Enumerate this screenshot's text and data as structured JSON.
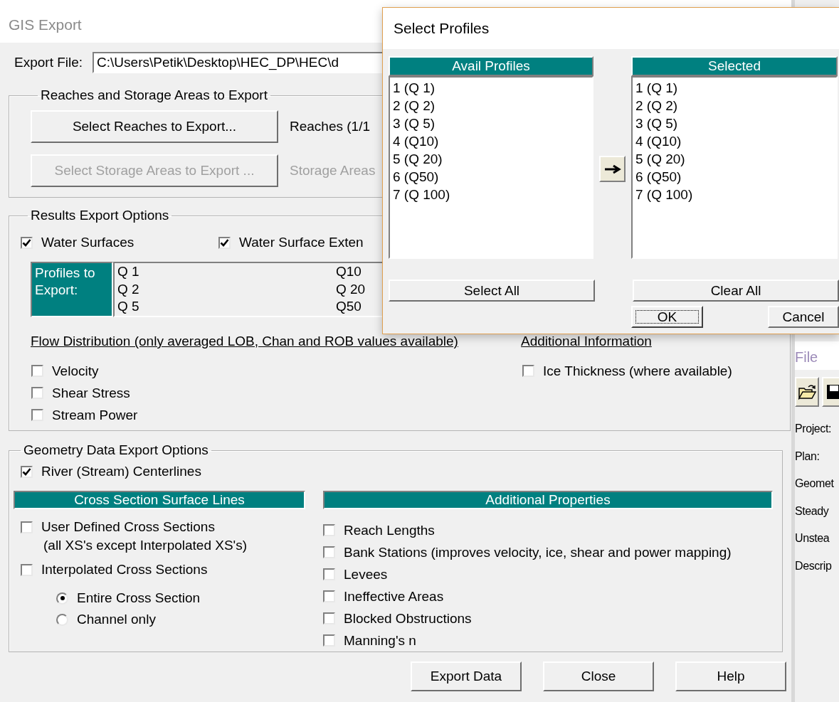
{
  "gis_export": {
    "title": "GIS Export",
    "export_file": {
      "label": "Export File:",
      "value": "C:\\Users\\Petik\\Desktop\\HEC_DP\\HEC\\d"
    },
    "reaches_group": {
      "title": "Reaches and Storage Areas to Export",
      "rows": [
        {
          "button": "Select Reaches to Export...",
          "status": "Reaches (1/1",
          "disabled": false
        },
        {
          "button": "Select Storage Areas to Export ...",
          "status": "Storage Areas",
          "disabled": true
        }
      ]
    },
    "results_group": {
      "title": "Results Export Options",
      "options": [
        {
          "label": "Water Surfaces",
          "checked": true
        },
        {
          "label": "Water Surface Exten",
          "checked": true
        }
      ],
      "profiles_label": "Profiles to Export:",
      "profile_columns": [
        {
          "items": [
            "Q 1",
            "Q 2",
            "Q 5"
          ]
        },
        {
          "items": [
            "Q10",
            "Q 20",
            "Q50"
          ]
        }
      ],
      "flow_distribution": {
        "title": "Flow Distribution (only averaged LOB, Chan and ROB values available)",
        "options": [
          {
            "label": "Velocity",
            "checked": false
          },
          {
            "label": "Shear Stress",
            "checked": false
          },
          {
            "label": "Stream Power",
            "checked": false
          }
        ]
      },
      "additional_information": {
        "title": "Additional Information",
        "options": [
          {
            "label": "Ice Thickness (where available)",
            "checked": false
          }
        ]
      }
    },
    "geometry_group": {
      "title": "Geometry Data Export Options",
      "centerlines": {
        "label": "River (Stream) Centerlines",
        "checked": true
      },
      "cross_sections": {
        "header": "Cross Section Surface Lines",
        "options": [
          {
            "label": "User Defined Cross Sections",
            "note": "(all XS's except Interpolated XS's)",
            "checked": false
          },
          {
            "label": "Interpolated Cross Sections",
            "checked": false
          }
        ],
        "extent": [
          {
            "label": "Entire Cross Section",
            "selected": true
          },
          {
            "label": "Channel only",
            "selected": false
          }
        ]
      },
      "additional_properties": {
        "header": "Additional Properties",
        "options": [
          {
            "label": "Reach Lengths",
            "checked": false
          },
          {
            "label": "Bank Stations (improves velocity, ice, shear and power mapping)",
            "checked": false
          },
          {
            "label": "Levees",
            "checked": false
          },
          {
            "label": "Ineffective Areas",
            "checked": false
          },
          {
            "label": "Blocked Obstructions",
            "checked": false
          },
          {
            "label": "Manning's n",
            "checked": false
          }
        ]
      }
    },
    "buttons": [
      "Export Data",
      "Close",
      "Help"
    ]
  },
  "select_profiles": {
    "title": "Select Profiles",
    "available": {
      "header": "Avail Profiles",
      "items": [
        "1 (Q 1)",
        "2 (Q 2)",
        "3 (Q 5)",
        "4 (Q10)",
        "5 (Q 20)",
        "6 (Q50)",
        "7 (Q 100)"
      ]
    },
    "selected": {
      "header": "Selected",
      "items": [
        "1 (Q 1)",
        "2 (Q 2)",
        "3 (Q 5)",
        "4 (Q10)",
        "5 (Q 20)",
        "6 (Q50)",
        "7 (Q 100)"
      ]
    },
    "select_all": "Select All",
    "clear_all": "Clear All",
    "ok": "OK",
    "cancel": "Cancel"
  },
  "main_window": {
    "menu": [
      "File"
    ],
    "labels": [
      "Project:",
      "Plan:",
      "Geomet",
      "Steady",
      "Unstea",
      "Descrip"
    ]
  }
}
